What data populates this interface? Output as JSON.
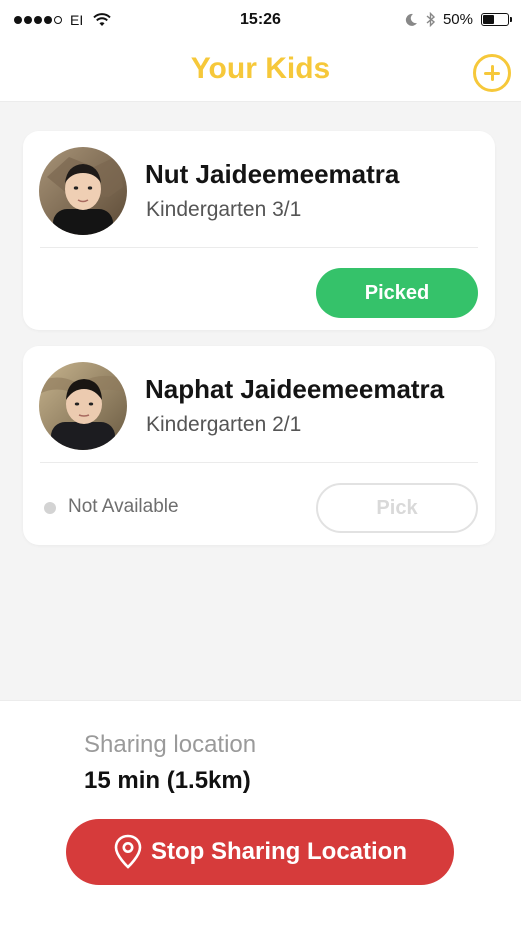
{
  "status_bar": {
    "carrier": "EI",
    "time": "15:26",
    "battery": "50%",
    "battery_level": 0.5,
    "signal_bars": 4,
    "signal_total": 5
  },
  "header": {
    "title": "Your Kids",
    "add_icon": "plus-circle-icon"
  },
  "kids": [
    {
      "name": "Nut Jaideemeematra",
      "class": "Kindergarten 3/1",
      "action_label": "Picked",
      "action_color": "#35c26a"
    },
    {
      "name": "Naphat Jaideemeematra",
      "class": "Kindergarten 2/1",
      "status": "Not Available",
      "action_label": "Pick"
    }
  ],
  "sharing": {
    "label": "Sharing location",
    "value": "15 min (1.5km)",
    "stop_label": "Stop Sharing Location",
    "stop_icon": "location-pin-icon",
    "stop_color": "#d63b3b"
  },
  "colors": {
    "accent": "#f6c83a"
  }
}
